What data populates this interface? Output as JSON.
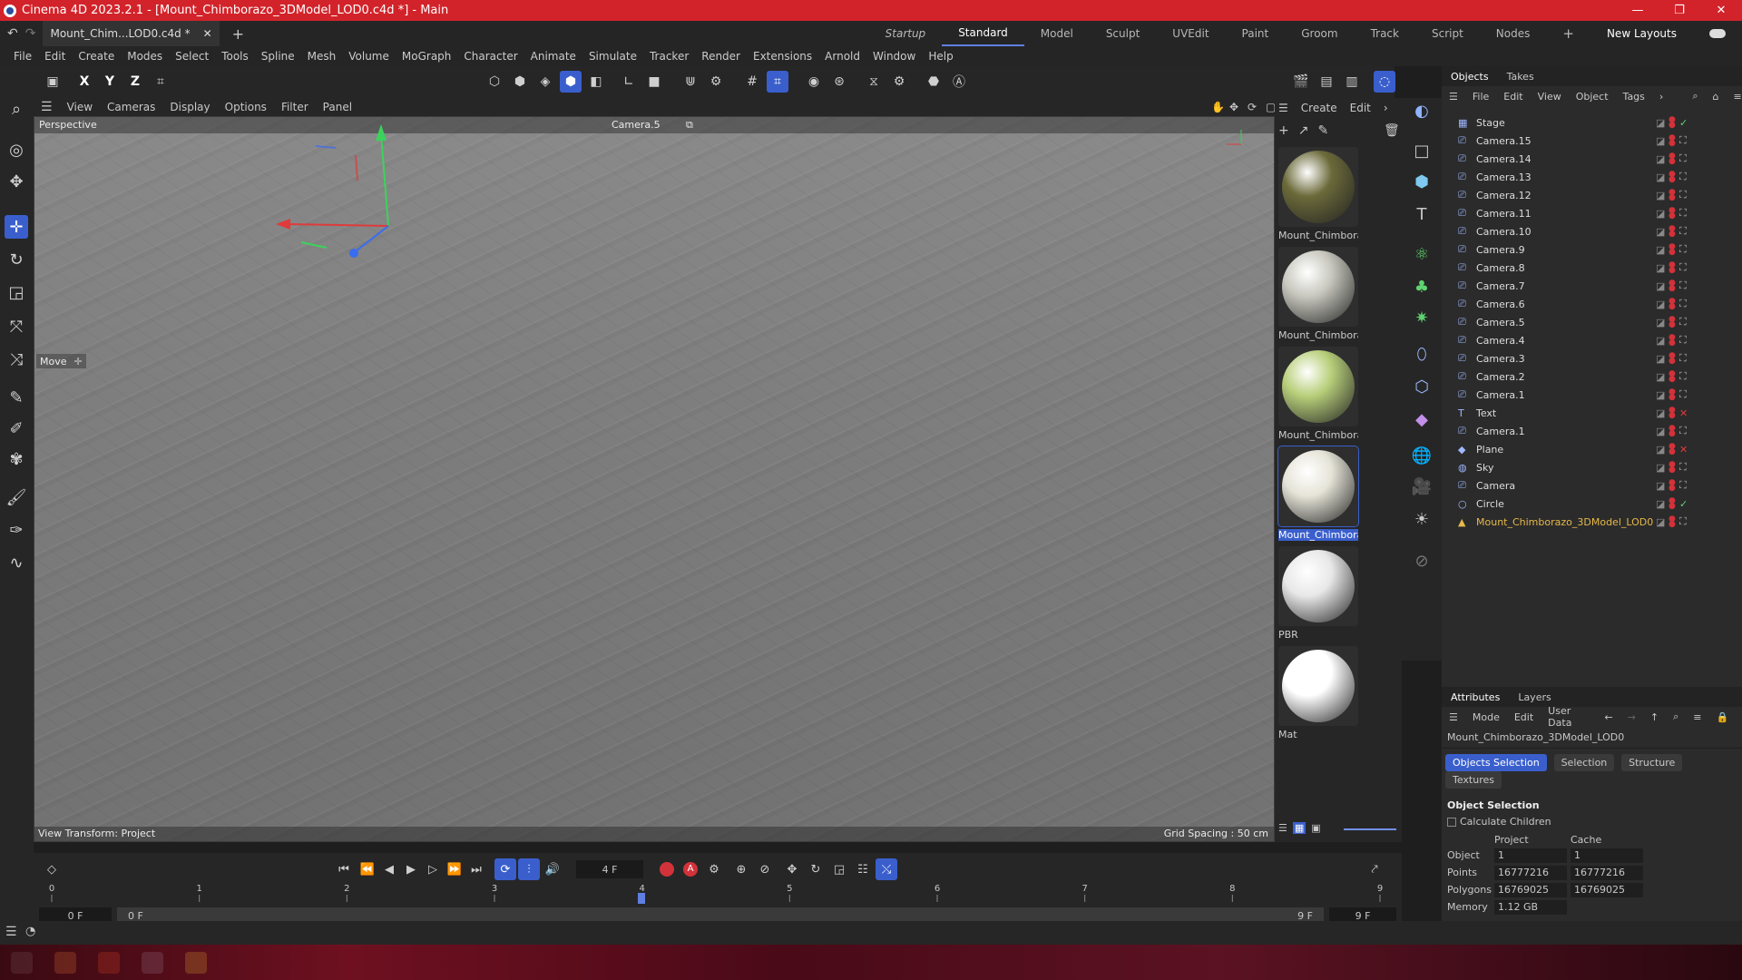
{
  "title": "Cinema 4D 2023.2.1 - [Mount_Chimborazo_3DModel_LOD0.c4d *] - Main",
  "doc_tab": "Mount_Chim...LOD0.c4d *",
  "layouts": [
    "Startup",
    "Standard",
    "Model",
    "Sculpt",
    "UVEdit",
    "Paint",
    "Groom",
    "Track",
    "Script",
    "Nodes"
  ],
  "new_layouts": "New Layouts",
  "menu": [
    "File",
    "Edit",
    "Create",
    "Modes",
    "Select",
    "Tools",
    "Spline",
    "Mesh",
    "Volume",
    "MoGraph",
    "Character",
    "Animate",
    "Simulate",
    "Tracker",
    "Render",
    "Extensions",
    "Arnold",
    "Window",
    "Help"
  ],
  "axis_labels": {
    "x": "X",
    "y": "Y",
    "z": "Z"
  },
  "viewport_menu": [
    "View",
    "Cameras",
    "Display",
    "Options",
    "Filter",
    "Panel"
  ],
  "viewport": {
    "name": "Perspective",
    "camera": "Camera.5",
    "tool": "Move",
    "view_transform": "View Transform: Project",
    "grid_spacing": "Grid Spacing : 50 cm"
  },
  "mat_menu": {
    "create": "Create",
    "edit": "Edit"
  },
  "materials": [
    {
      "name": "Mount_Chimbora:",
      "color": "#6b6a3a"
    },
    {
      "name": "Mount_Chimbora:",
      "color": "#c8c8bf"
    },
    {
      "name": "Mount_Chimbora:",
      "color": "#b8cf7a"
    },
    {
      "name": "Mount_Chimbora:",
      "color": "#e6e4d8"
    },
    {
      "name": "PBR",
      "color": "#e8e8e8"
    },
    {
      "name": "Mat",
      "color": "#ffffff"
    }
  ],
  "objects_tabs": [
    "Objects",
    "Takes"
  ],
  "objects_menu": [
    "File",
    "Edit",
    "View",
    "Object",
    "Tags"
  ],
  "objects": [
    "Stage",
    "Camera.15",
    "Camera.14",
    "Camera.13",
    "Camera.12",
    "Camera.11",
    "Camera.10",
    "Camera.9",
    "Camera.8",
    "Camera.7",
    "Camera.6",
    "Camera.5",
    "Camera.4",
    "Camera.3",
    "Camera.2",
    "Camera.1",
    "Text",
    "Camera.1",
    "Plane",
    "Sky",
    "Camera",
    "Circle",
    "Mount_Chimborazo_3DModel_LOD0"
  ],
  "attributes": {
    "tabs": [
      "Attributes",
      "Layers"
    ],
    "menu": [
      "Mode",
      "Edit",
      "User Data"
    ],
    "object_name": "Mount_Chimborazo_3DModel_LOD0",
    "subtabs": [
      "Objects Selection",
      "Selection",
      "Structure",
      "Textures"
    ],
    "section": "Object Selection",
    "calc_children": "Calculate Children",
    "col_project": "Project",
    "col_cache": "Cache",
    "rows": [
      {
        "label": "Object",
        "project": "1",
        "cache": "1"
      },
      {
        "label": "Points",
        "project": "16777216",
        "cache": "16777216"
      },
      {
        "label": "Polygons",
        "project": "16769025",
        "cache": "16769025"
      },
      {
        "label": "Memory",
        "project": "1.12 GB",
        "cache": ""
      }
    ]
  },
  "timeline": {
    "frame": "4 F",
    "start": "0 F",
    "start2": "0 F",
    "end": "9 F",
    "end2": "9 F",
    "ticks": [
      "0",
      "1",
      "2",
      "3",
      "4",
      "5",
      "6",
      "7",
      "8",
      "9"
    ],
    "current_frac": 0.444
  }
}
